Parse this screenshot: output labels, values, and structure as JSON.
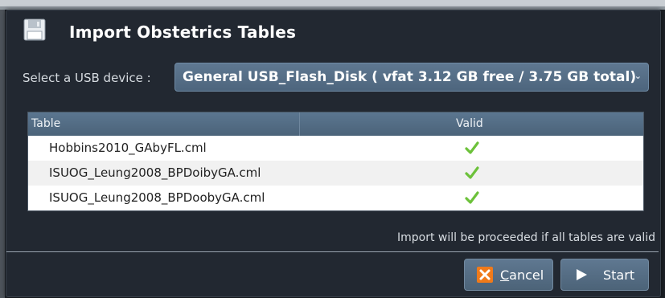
{
  "dialog": {
    "title": "Import Obstetrics Tables",
    "title_icon": "floppy-disk-icon"
  },
  "usb": {
    "label": "Select a USB device :",
    "selected": "General USB_Flash_Disk ( vfat 3.12 GB free / 3.75 GB total)"
  },
  "table": {
    "headers": [
      "Table",
      "Valid"
    ],
    "rows": [
      {
        "name": "Hobbins2010_GAbyFL.cml",
        "valid": "check-icon"
      },
      {
        "name": "ISUOG_Leung2008_BPDoibyGA.cml",
        "valid": "check-icon"
      },
      {
        "name": "ISUOG_Leung2008_BPDoobyGA.cml",
        "valid": "check-icon"
      }
    ]
  },
  "hint": "Import will be proceeded if all tables are valid",
  "buttons": {
    "cancel_first": "C",
    "cancel_rest": "ancel",
    "start": "Start"
  },
  "colors": {
    "accent": "#5f7891",
    "check": "#6cc13a",
    "cancel_icon": "#f07a1a"
  }
}
